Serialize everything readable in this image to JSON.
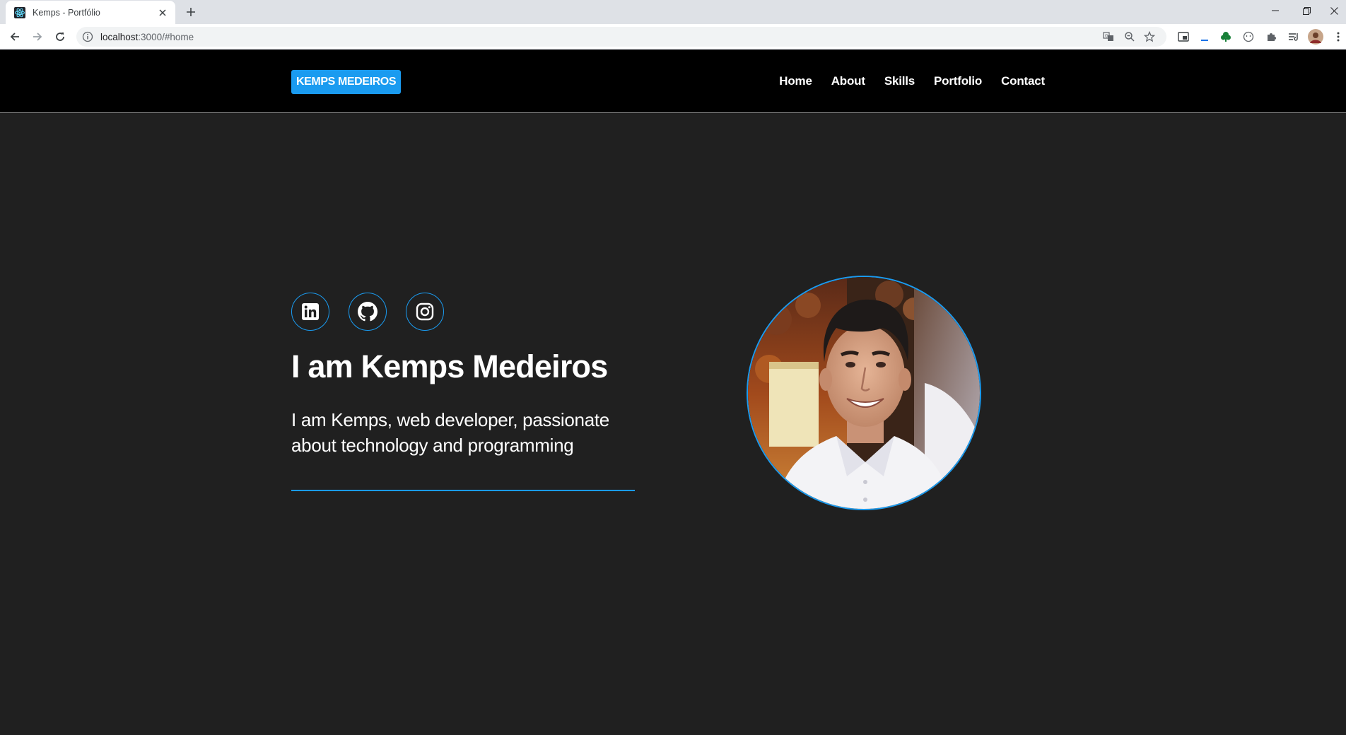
{
  "browser": {
    "tab_title": "Kemps - Portfólio",
    "url_host": "localhost",
    "url_rest": ":3000/#home",
    "icons": [
      "react-favicon",
      "close-icon",
      "plus-icon",
      "minimize-icon",
      "restore-icon",
      "window-close-icon",
      "back-arrow-icon",
      "forward-arrow-icon",
      "reload-icon",
      "info-icon",
      "translate-icon",
      "zoom-icon",
      "star-icon",
      "media-icon",
      "extension-icon",
      "tree-icon",
      "face-icon",
      "puzzle-icon",
      "reading-list-icon",
      "profile-avatar",
      "kebab-menu-icon"
    ]
  },
  "nav": {
    "logo": "KEMPS MEDEIROS",
    "links": [
      "Home",
      "About",
      "Skills",
      "Portfolio",
      "Contact"
    ]
  },
  "hero": {
    "socials": [
      "linkedin-icon",
      "github-icon",
      "instagram-icon"
    ],
    "title": "I am Kemps Medeiros",
    "subtitle": "I am Kemps, web developer, passionate about technology and programming"
  },
  "colors": {
    "accent": "#1a9bf0",
    "page_bg": "#202020",
    "nav_bg": "#000000",
    "text": "#ffffff"
  }
}
